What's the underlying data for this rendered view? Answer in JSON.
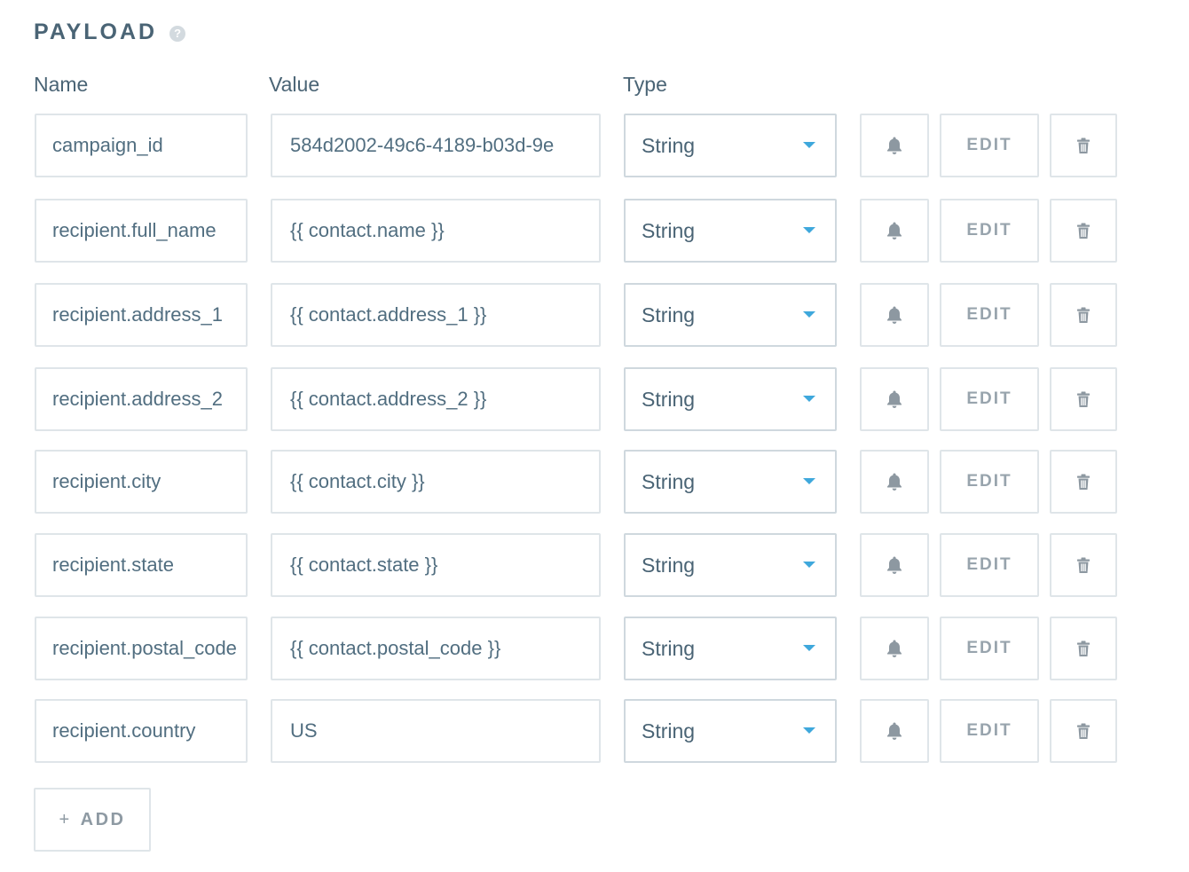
{
  "section": {
    "title": "PAYLOAD",
    "help_icon": "question-circle-icon"
  },
  "columns": {
    "name": "Name",
    "value": "Value",
    "type": "Type"
  },
  "rows": [
    {
      "name": "campaign_id",
      "value": "584d2002-49c6-4189-b03d-9e",
      "type": "String",
      "edit_label": "EDIT"
    },
    {
      "name": "recipient.full_name",
      "value": "{{ contact.name }}",
      "type": "String",
      "edit_label": "EDIT"
    },
    {
      "name": "recipient.address_1",
      "value": "{{ contact.address_1 }}",
      "type": "String",
      "edit_label": "EDIT"
    },
    {
      "name": "recipient.address_2",
      "value": "{{ contact.address_2 }}",
      "type": "String",
      "edit_label": "EDIT"
    },
    {
      "name": "recipient.city",
      "value": "{{ contact.city }}",
      "type": "String",
      "edit_label": "EDIT"
    },
    {
      "name": "recipient.state",
      "value": "{{ contact.state }}",
      "type": "String",
      "edit_label": "EDIT"
    },
    {
      "name": "recipient.postal_code",
      "value": "{{ contact.postal_code }}",
      "type": "String",
      "edit_label": "EDIT"
    },
    {
      "name": "recipient.country",
      "value": "US",
      "type": "String",
      "edit_label": "EDIT"
    }
  ],
  "add_button": {
    "plus": "+",
    "label": "ADD"
  },
  "icons": {
    "row_notify": "bell-icon",
    "row_delete": "trash-icon",
    "type_dropdown": "caret-down-icon"
  },
  "colors": {
    "text": "#4e6b7c",
    "border": "#dfe5e9",
    "accent": "#3fa8dc",
    "muted_button": "#98a4ad"
  }
}
